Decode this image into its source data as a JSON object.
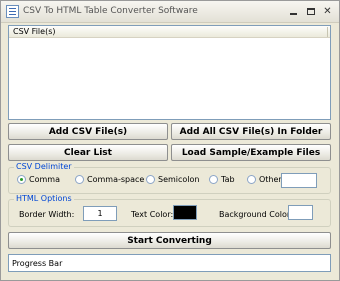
{
  "window": {
    "title": "CSV To HTML Table Converter Software",
    "minimize_glyph": "",
    "maximize_glyph": "",
    "close_glyph": "✕"
  },
  "file_list": {
    "column_header": "CSV File(s)",
    "items": []
  },
  "buttons": {
    "add_csv": "Add CSV File(s)",
    "add_folder": "Add All CSV File(s) In Folder",
    "clear_list": "Clear List",
    "load_sample": "Load Sample/Example Files",
    "start": "Start Converting"
  },
  "csv_delimiter": {
    "legend": "CSV Delimiter",
    "options": [
      {
        "label": "Comma",
        "checked": true
      },
      {
        "label": "Comma-space",
        "checked": false
      },
      {
        "label": "Semicolon",
        "checked": false
      },
      {
        "label": "Tab",
        "checked": false
      },
      {
        "label": "Other",
        "checked": false
      }
    ],
    "other_value": ""
  },
  "html_options": {
    "legend": "HTML Options",
    "border_width_label": "Border Width:",
    "border_width_value": "1",
    "text_color_label": "Text Color:",
    "text_color": "#000000",
    "background_color_label": "Background Color:",
    "background_color": "#ffffff"
  },
  "progress": {
    "label": "Progress Bar"
  },
  "colors": {
    "window_bg": "#ece9d8",
    "group_legend": "#0046d5",
    "field_border": "#7f9db9"
  }
}
